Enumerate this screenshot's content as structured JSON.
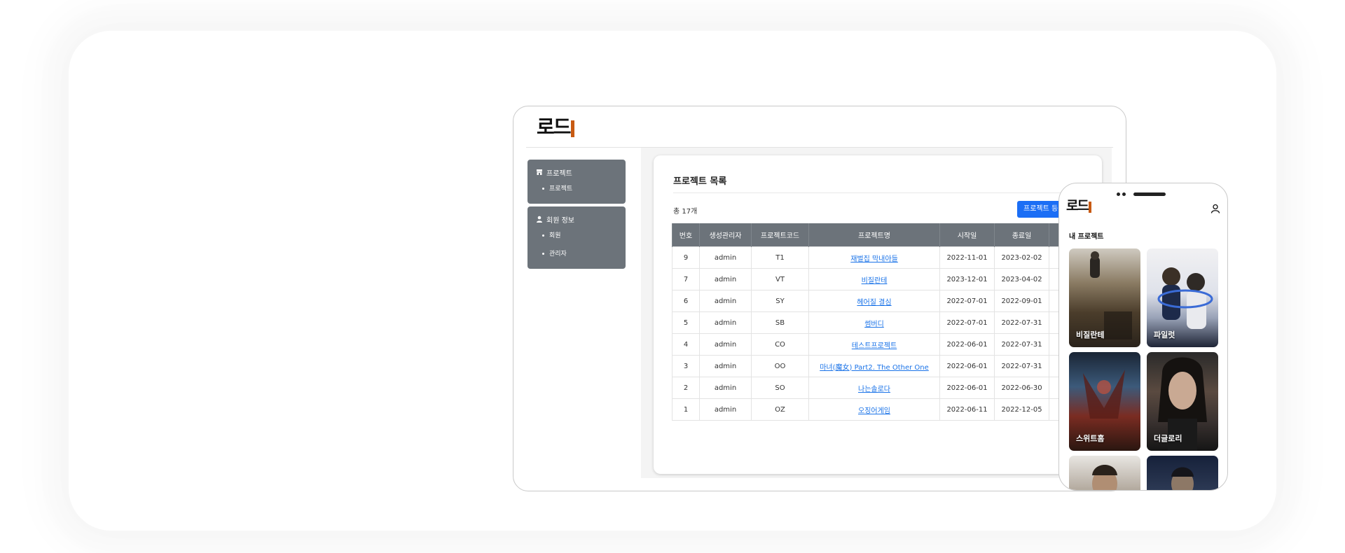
{
  "desktop": {
    "logo_text": "로드",
    "sidebar": {
      "groups": [
        {
          "title": "프로젝트",
          "icon": "store-icon",
          "items": [
            "프로젝트"
          ]
        },
        {
          "title": "회원 정보",
          "icon": "user-icon",
          "items": [
            "회원",
            "관리자"
          ]
        }
      ]
    },
    "card": {
      "title": "프로젝트 목록",
      "total": "총 17개",
      "register_button": "프로젝트 등",
      "columns": [
        "번호",
        "생성관리자",
        "프로젝트코드",
        "프로젝트명",
        "시작일",
        "종료일",
        ""
      ],
      "rows": [
        {
          "no": "9",
          "admin": "admin",
          "code": "T1",
          "name": "재벌집 막내아들",
          "start": "2022-11-01",
          "end": "2023-02-02"
        },
        {
          "no": "7",
          "admin": "admin",
          "code": "VT",
          "name": "비질란테",
          "start": "2023-12-01",
          "end": "2023-04-02"
        },
        {
          "no": "6",
          "admin": "admin",
          "code": "SY",
          "name": "헤어질 결심",
          "start": "2022-07-01",
          "end": "2022-09-01"
        },
        {
          "no": "5",
          "admin": "admin",
          "code": "SB",
          "name": "썸버디",
          "start": "2022-07-01",
          "end": "2022-07-31"
        },
        {
          "no": "4",
          "admin": "admin",
          "code": "CO",
          "name": "테스트프로젝트",
          "start": "2022-06-01",
          "end": "2022-07-31"
        },
        {
          "no": "3",
          "admin": "admin",
          "code": "OO",
          "name": "마녀(魔女) Part2. The Other One",
          "start": "2022-06-01",
          "end": "2022-07-31"
        },
        {
          "no": "2",
          "admin": "admin",
          "code": "SO",
          "name": "나는솔로다",
          "start": "2022-06-01",
          "end": "2022-06-30"
        },
        {
          "no": "1",
          "admin": "admin",
          "code": "OZ",
          "name": "오징어게임",
          "start": "2022-06-11",
          "end": "2022-12-05"
        }
      ]
    }
  },
  "mobile": {
    "logo_text": "로드",
    "section_title": "내 프로젝트",
    "posters": [
      {
        "title": "비질란테"
      },
      {
        "title": "파일럿"
      },
      {
        "title": "스위트홈"
      },
      {
        "title": "더글로리"
      },
      {
        "title": ""
      },
      {
        "title": ""
      }
    ]
  }
}
